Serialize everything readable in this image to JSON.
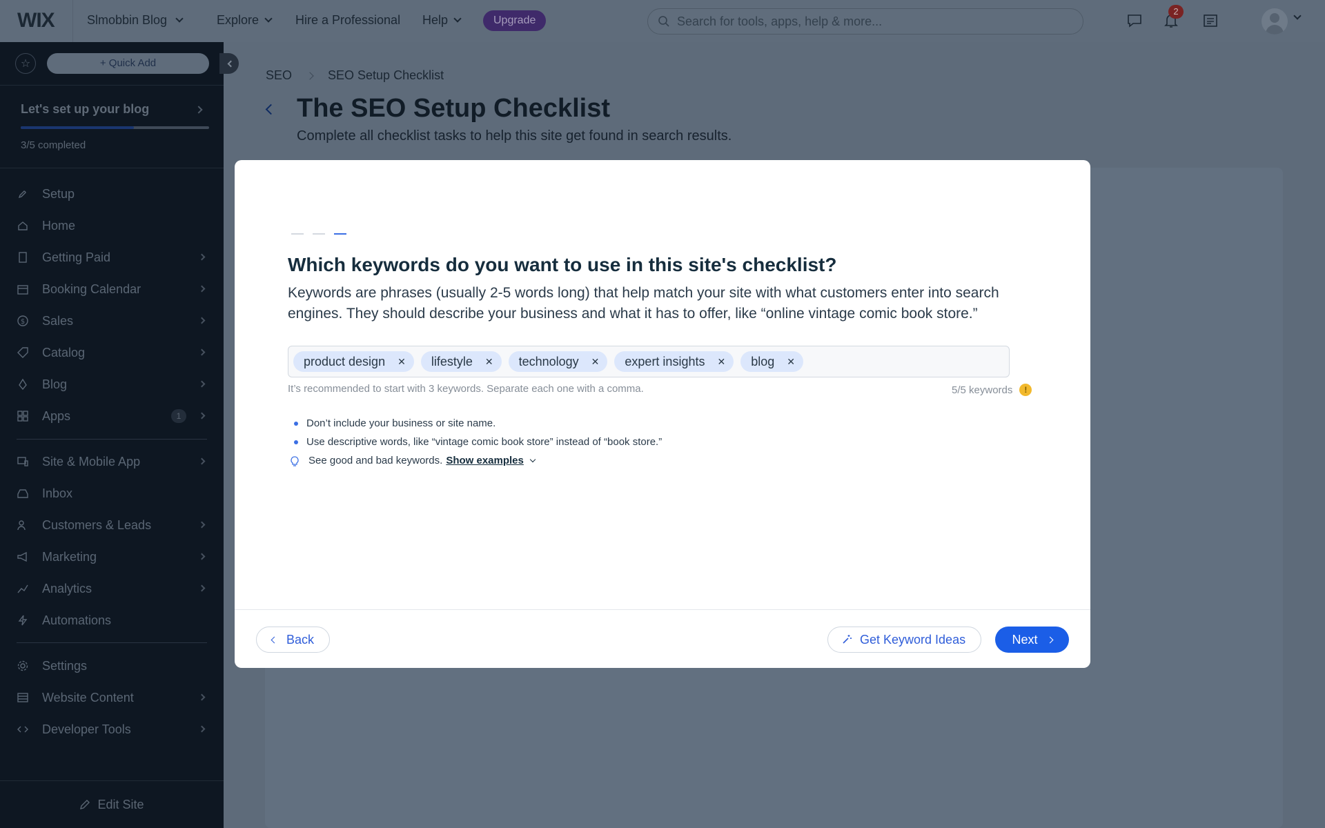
{
  "topbar": {
    "logo": "WIX",
    "site_name": "Slmobbin Blog",
    "nav": [
      {
        "label": "Explore"
      },
      {
        "label": "Hire a Professional"
      },
      {
        "label": "Help"
      }
    ],
    "upgrade_label": "Upgrade",
    "search_placeholder": "Search for tools, apps, help & more...",
    "notification_count": "2"
  },
  "sidebar": {
    "quick_add_label": "+ Quick Add",
    "setup": {
      "title": "Let's set up your blog",
      "progress_text": "3/5 completed",
      "progress_fraction": 0.6
    },
    "items": [
      {
        "label": "Setup",
        "icon": "rocket-icon"
      },
      {
        "label": "Home",
        "icon": "home-icon"
      },
      {
        "label": "Getting Paid",
        "icon": "receipt-icon"
      },
      {
        "label": "Booking Calendar",
        "icon": "calendar-icon"
      },
      {
        "label": "Sales",
        "icon": "dollar-icon"
      },
      {
        "label": "Catalog",
        "icon": "tag-icon"
      },
      {
        "label": "Blog",
        "icon": "pen-nib-icon"
      },
      {
        "label": "Apps",
        "icon": "apps-icon",
        "count": "1"
      },
      {
        "label": "Site & Mobile App",
        "icon": "devices-icon"
      },
      {
        "label": "Inbox",
        "icon": "inbox-icon"
      },
      {
        "label": "Customers & Leads",
        "icon": "people-icon"
      },
      {
        "label": "Marketing",
        "icon": "megaphone-icon"
      },
      {
        "label": "Analytics",
        "icon": "chart-icon"
      },
      {
        "label": "Automations",
        "icon": "bolt-icon"
      },
      {
        "label": "Settings",
        "icon": "gear-icon"
      },
      {
        "label": "Website Content",
        "icon": "table-icon"
      },
      {
        "label": "Developer Tools",
        "icon": "code-icon"
      }
    ],
    "edit_site_label": "Edit Site"
  },
  "page": {
    "breadcrumb": [
      "SEO",
      "SEO Setup Checklist"
    ],
    "title": "The SEO Setup Checklist",
    "subtitle": "Complete all checklist tasks to help this site get found in search results."
  },
  "modal": {
    "step_total": 3,
    "step_current": 3,
    "title": "Which keywords do you want to use in this site's checklist?",
    "description": "Keywords are phrases (usually 2-5 words long) that help match your site with what customers enter into search engines. They should describe your business and what it has to offer, like “online vintage comic book store.”",
    "keywords": [
      "product design",
      "lifestyle",
      "technology",
      "expert insights",
      "blog"
    ],
    "hint": "It’s recommended to start with 3 keywords. Separate each one with a comma.",
    "keyword_count": "5/5 keywords",
    "tips": [
      "Don’t include your business or site name.",
      "Use descriptive words, like “vintage comic book store” instead of “book store.”"
    ],
    "examples_text": "See good and bad keywords.",
    "show_examples_label": "Show examples",
    "back_label": "Back",
    "ideas_label": "Get Keyword Ideas",
    "next_label": "Next",
    "accent_color": "#1b5ee7"
  }
}
